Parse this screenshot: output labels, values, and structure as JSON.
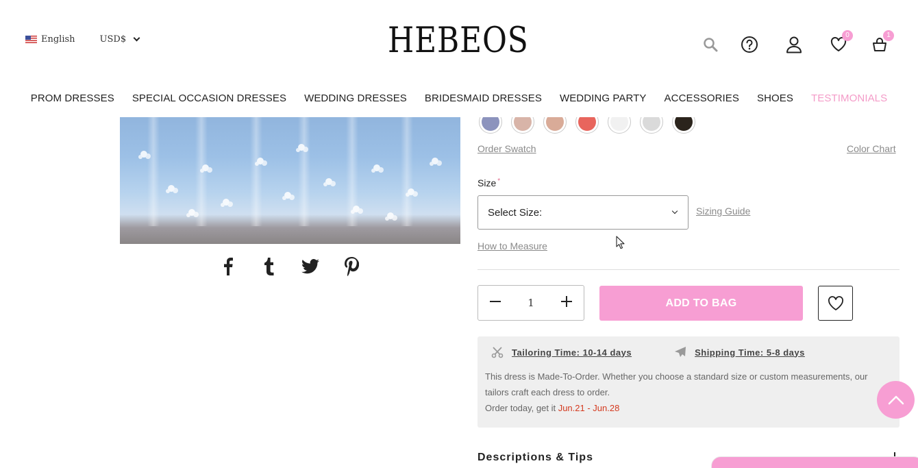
{
  "header": {
    "language": "English",
    "currency": "USD$",
    "logo": "HEBEOS",
    "wishlist_count": "0",
    "cart_count": "1"
  },
  "nav": {
    "items": [
      "PROM DRESSES",
      "SPECIAL OCCASION DRESSES",
      "WEDDING DRESSES",
      "BRIDESMAID DRESSES",
      "WEDDING PARTY",
      "ACCESSORIES",
      "SHOES",
      "TESTIMONIALS"
    ]
  },
  "colors": {
    "accent_pink": "#f79ed3",
    "nav_highlight": "#f49bc8",
    "date_red": "#d43a1f",
    "swatches": [
      "#8c93bd",
      "#d8b4a8",
      "#d9ab98",
      "#e8655d",
      "#f1f1f1",
      "#dadada",
      "#2b241c"
    ]
  },
  "product": {
    "order_swatch": "Order Swatch",
    "color_chart": "Color Chart",
    "size_label": "Size",
    "size_required_mark": "*",
    "size_select_value": "Select Size:",
    "sizing_guide": "Sizing Guide",
    "how_to_measure": "How to Measure",
    "quantity": "1",
    "add_to_bag": "ADD TO BAG"
  },
  "info": {
    "tailoring": "Tailoring Time: 10-14 days",
    "shipping": "Shipping Time: 5-8 days",
    "made_to_order": "This dress is Made-To-Order. Whether you choose a standard size or custom measurements, our tailors craft each dress to order.",
    "order_today": "Order today, get it ",
    "delivery_dates": "Jun.21 - Jun.28"
  },
  "descriptions": {
    "title": "Descriptions & Tips"
  },
  "share": [
    "facebook-icon",
    "tumblr-icon",
    "twitter-icon",
    "pinterest-icon"
  ]
}
